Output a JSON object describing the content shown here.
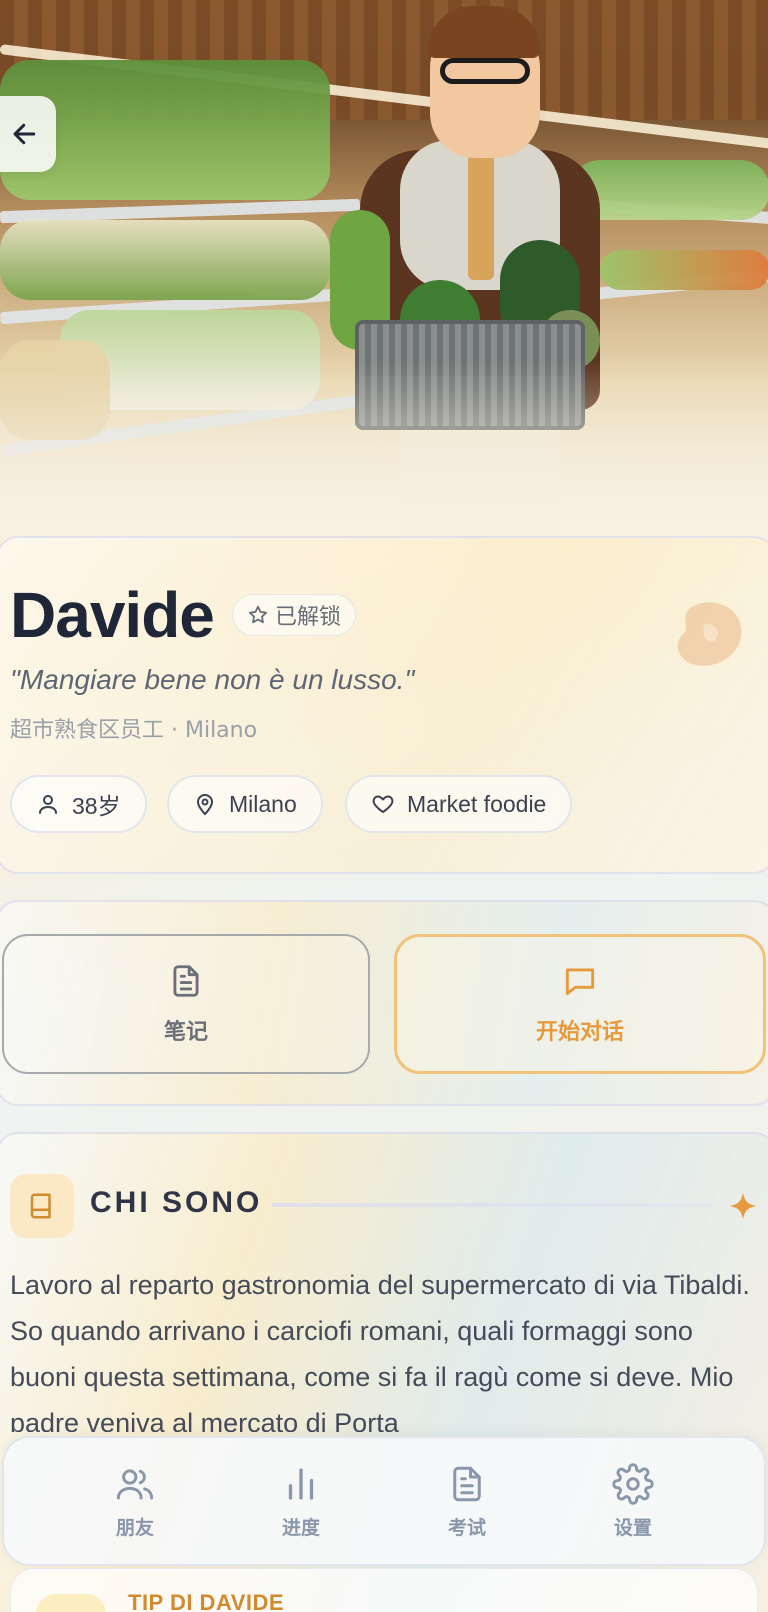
{
  "header": {
    "back_icon": "arrow-left-icon"
  },
  "profile": {
    "name": "Davide",
    "badge": "已解锁",
    "badge_icon": "star-icon",
    "quote": "\"Mangiare bene non è un lusso.\"",
    "subtitle": "超市熟食区员工 · Milano",
    "corner_icon": "steak-icon",
    "chips": [
      {
        "icon": "person-icon",
        "label": "38岁"
      },
      {
        "icon": "location-pin-icon",
        "label": "Milano"
      },
      {
        "icon": "heart-icon",
        "label": "Market foodie"
      }
    ]
  },
  "actions": {
    "notes_label": "笔记",
    "chat_label": "开始对话"
  },
  "about": {
    "title": "CHI SONO",
    "text": "Lavoro al reparto gastronomia del supermercato di via Tibaldi. So quando arrivano i carciofi romani, quali formaggi sono buoni questa settimana, come si fa il ragù come si deve. Mio padre veniva al mercato di Porta"
  },
  "nav": {
    "items": [
      {
        "icon": "friends-icon",
        "label": "朋友"
      },
      {
        "icon": "bar-chart-icon",
        "label": "进度"
      },
      {
        "icon": "document-icon",
        "label": "考试"
      },
      {
        "icon": "gear-icon",
        "label": "设置"
      }
    ]
  },
  "tip": {
    "title": "TIP DI DAVIDE"
  },
  "colors": {
    "accent": "#e69a3c",
    "text_dark": "#1f2638",
    "nav_inactive": "#8a97aa"
  }
}
